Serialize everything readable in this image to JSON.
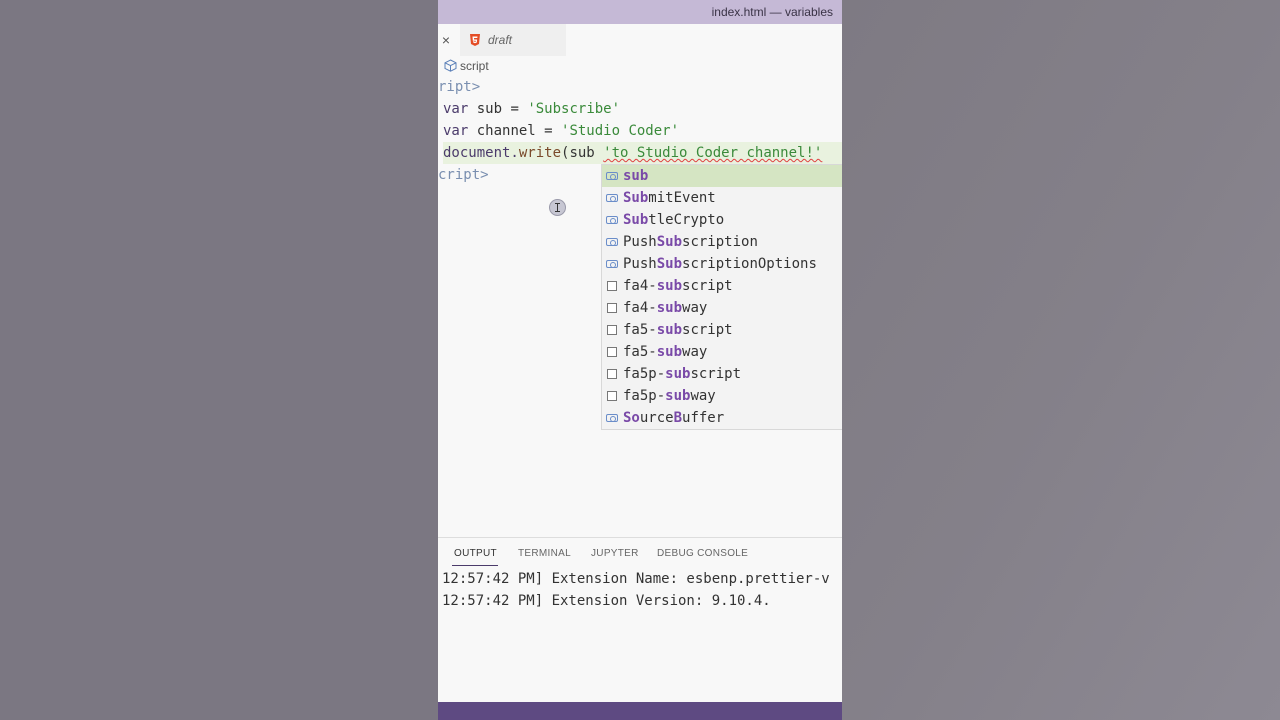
{
  "window": {
    "title": "index.html — variables"
  },
  "tabs": {
    "close": "×",
    "draft": "draft"
  },
  "breadcrumb": {
    "label": "script"
  },
  "code": {
    "line1": "ript>",
    "line2_kw": "var",
    "line2_rest": " sub = ",
    "line2_str": "'Subscribe'",
    "line3_kw": "var",
    "line3_rest": " channel = ",
    "line3_str": "'Studio Coder'",
    "line4_obj": "document.",
    "line4_fn": "write",
    "line4_paren": "(sub ",
    "line4_str": "'to Studio Coder channel!'",
    "line5": "cript>"
  },
  "suggestions": [
    {
      "hl": "sub",
      "rest": "",
      "kind": "variable"
    },
    {
      "hl": "Sub",
      "rest": "mitEvent",
      "kind": "variable"
    },
    {
      "hl": "Sub",
      "rest": "tleCrypto",
      "kind": "variable"
    },
    {
      "pre": "Push",
      "hl": "Sub",
      "rest": "scription",
      "kind": "variable"
    },
    {
      "pre": "Push",
      "hl": "Sub",
      "rest": "scriptionOptions",
      "kind": "variable"
    },
    {
      "pre": "fa4-",
      "hl": "sub",
      "rest": "script",
      "kind": "text"
    },
    {
      "pre": "fa4-",
      "hl": "sub",
      "rest": "way",
      "kind": "text"
    },
    {
      "pre": "fa5-",
      "hl": "sub",
      "rest": "script",
      "kind": "text"
    },
    {
      "pre": "fa5-",
      "hl": "sub",
      "rest": "way",
      "kind": "text"
    },
    {
      "pre": "fa5p-",
      "hl": "sub",
      "rest": "script",
      "kind": "text"
    },
    {
      "pre": "fa5p-",
      "hl": "sub",
      "rest": "way",
      "kind": "text"
    },
    {
      "text": "SourceBuffer",
      "kind": "variable"
    }
  ],
  "panel": {
    "tabs": [
      "OUTPUT",
      "TERMINAL",
      "JUPYTER",
      "DEBUG CONSOLE"
    ],
    "active_tab": "OUTPUT",
    "lines": [
      "12:57:42 PM] Extension Name: esbenp.prettier-v",
      "12:57:42 PM] Extension Version: 9.10.4."
    ]
  },
  "colors": {
    "titlebar": "#c5b9d6",
    "statusbar": "#5e4a82",
    "suggest_selected": "#d5e5c3",
    "match_highlight": "#7a4aa8"
  }
}
